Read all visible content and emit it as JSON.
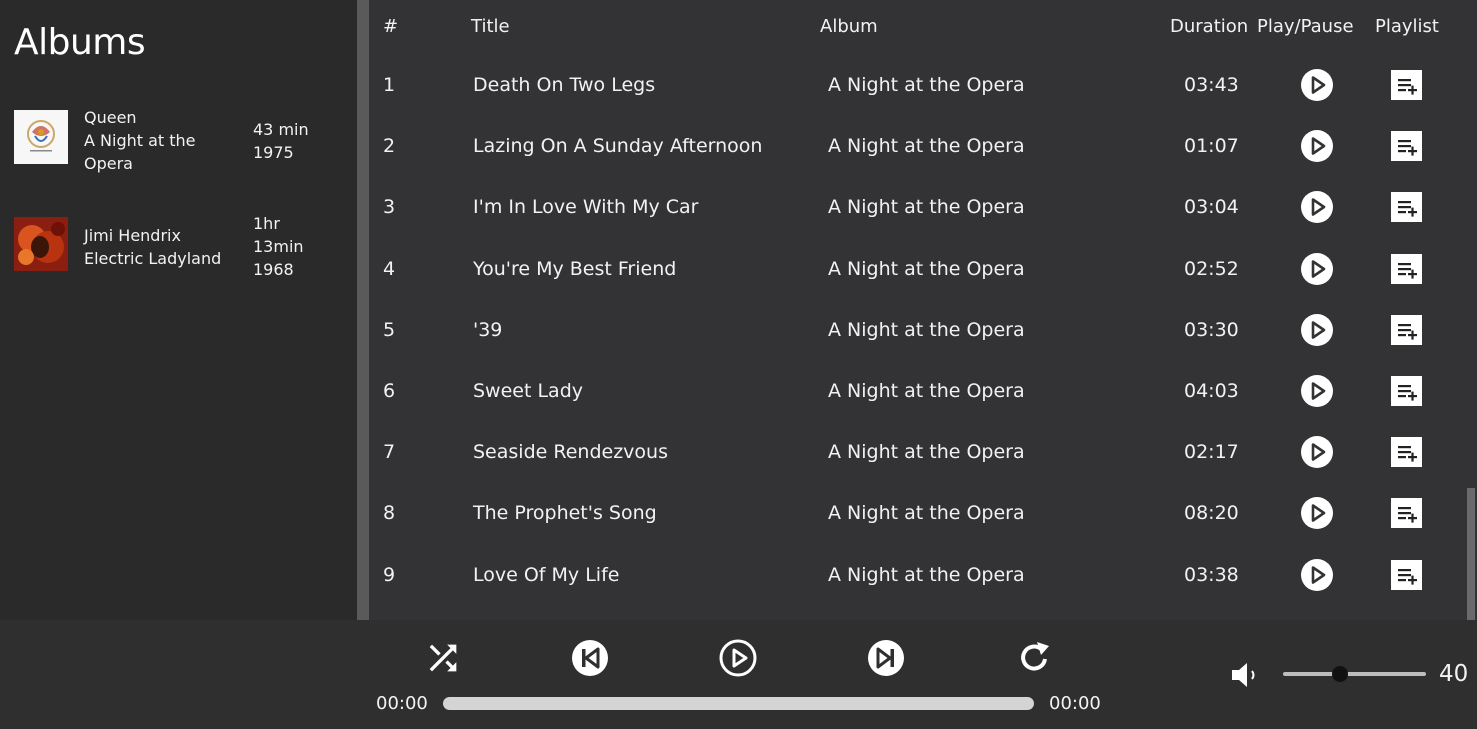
{
  "sidebar": {
    "title": "Albums",
    "albums": [
      {
        "artist": "Queen",
        "name": "A Night at the Opera",
        "length": "43 min",
        "year": "1975",
        "cover": "album-cover"
      },
      {
        "artist": "Jimi Hendrix",
        "name": "Electric Ladyland",
        "length": "1hr 13min",
        "year": "1968",
        "cover": "album-cover"
      }
    ]
  },
  "table": {
    "headers": {
      "num": "#",
      "title": "Title",
      "album": "Album",
      "duration": "Duration",
      "play": "Play/Pause",
      "playlist": "Playlist"
    },
    "rows": [
      {
        "num": "1",
        "title": "Death On Two Legs",
        "album": "A Night at the Opera",
        "duration": "03:43"
      },
      {
        "num": "2",
        "title": "Lazing On A Sunday Afternoon",
        "album": "A Night at the Opera",
        "duration": "01:07"
      },
      {
        "num": "3",
        "title": "I'm In Love With My Car",
        "album": "A Night at the Opera",
        "duration": "03:04"
      },
      {
        "num": "4",
        "title": "You're My Best Friend",
        "album": "A Night at the Opera",
        "duration": "02:52"
      },
      {
        "num": "5",
        "title": "'39",
        "album": "A Night at the Opera",
        "duration": "03:30"
      },
      {
        "num": "6",
        "title": "Sweet Lady",
        "album": "A Night at the Opera",
        "duration": "04:03"
      },
      {
        "num": "7",
        "title": "Seaside Rendezvous",
        "album": "A Night at the Opera",
        "duration": "02:17"
      },
      {
        "num": "8",
        "title": "The Prophet's Song",
        "album": "A Night at the Opera",
        "duration": "08:20"
      },
      {
        "num": "9",
        "title": "Love Of My Life",
        "album": "A Night at the Opera",
        "duration": "03:38"
      }
    ],
    "row_play_icon": "play-circle-icon",
    "row_playlist_icon": "playlist-add-icon"
  },
  "player": {
    "icons": [
      "shuffle-icon",
      "skip-previous-icon",
      "play-circle-icon",
      "skip-next-icon",
      "repeat-icon",
      "volume-icon"
    ],
    "current_time": "00:00",
    "total_time": "00:00",
    "progress": 0,
    "volume": 40,
    "volume_label": "40"
  },
  "colors": {
    "sidebar_bg": "#2a2a2a",
    "table_bg": "#333335",
    "player_bg": "#2f2f2f",
    "text": "#f2f2f2"
  }
}
